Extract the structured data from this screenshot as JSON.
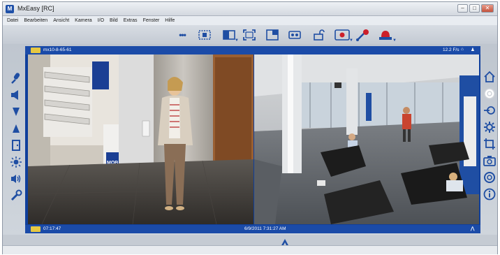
{
  "window": {
    "title": "MxEasy [RC]",
    "controls": [
      "minimize",
      "maximize",
      "close"
    ]
  },
  "menu": {
    "items": [
      "Datei",
      "Bearbeiten",
      "Ansicht",
      "Kamera",
      "I/O",
      "Bild",
      "Extras",
      "Fenster",
      "Hilfe"
    ]
  },
  "toolbar": {
    "icons": [
      "more-dots-icon",
      "sequence-icon",
      "layout-icon",
      "fullscreen-icon",
      "window-layout-icon",
      "tape-icon",
      "lock-icon",
      "record-icon",
      "signal-icon",
      "alarm-light-icon"
    ],
    "more_label": "•••"
  },
  "camera": {
    "name": "mx10-8-65-61",
    "framerate": "12.2 F/s",
    "time": "07:17:47",
    "datetime": "6/9/2011 7:31:27 AM",
    "logo_text": "MOBOTIX"
  },
  "left_controls": [
    "microphone-icon",
    "speaker-icon",
    "arrow-down-icon",
    "arrow-up-icon",
    "door-icon",
    "light-icon",
    "audio-wave-icon",
    "wrench-icon"
  ],
  "right_controls": [
    "home-icon",
    "gear-highlight-icon",
    "target-icon",
    "settings-icon",
    "crop-icon",
    "camera-icon",
    "lifebuoy-icon",
    "info-icon"
  ],
  "colors": {
    "accent_blue": "#1b4ba8",
    "icon_blue": "#1f4ea3",
    "record_red": "#cc1f2a",
    "badge_yellow": "#e6c843"
  }
}
